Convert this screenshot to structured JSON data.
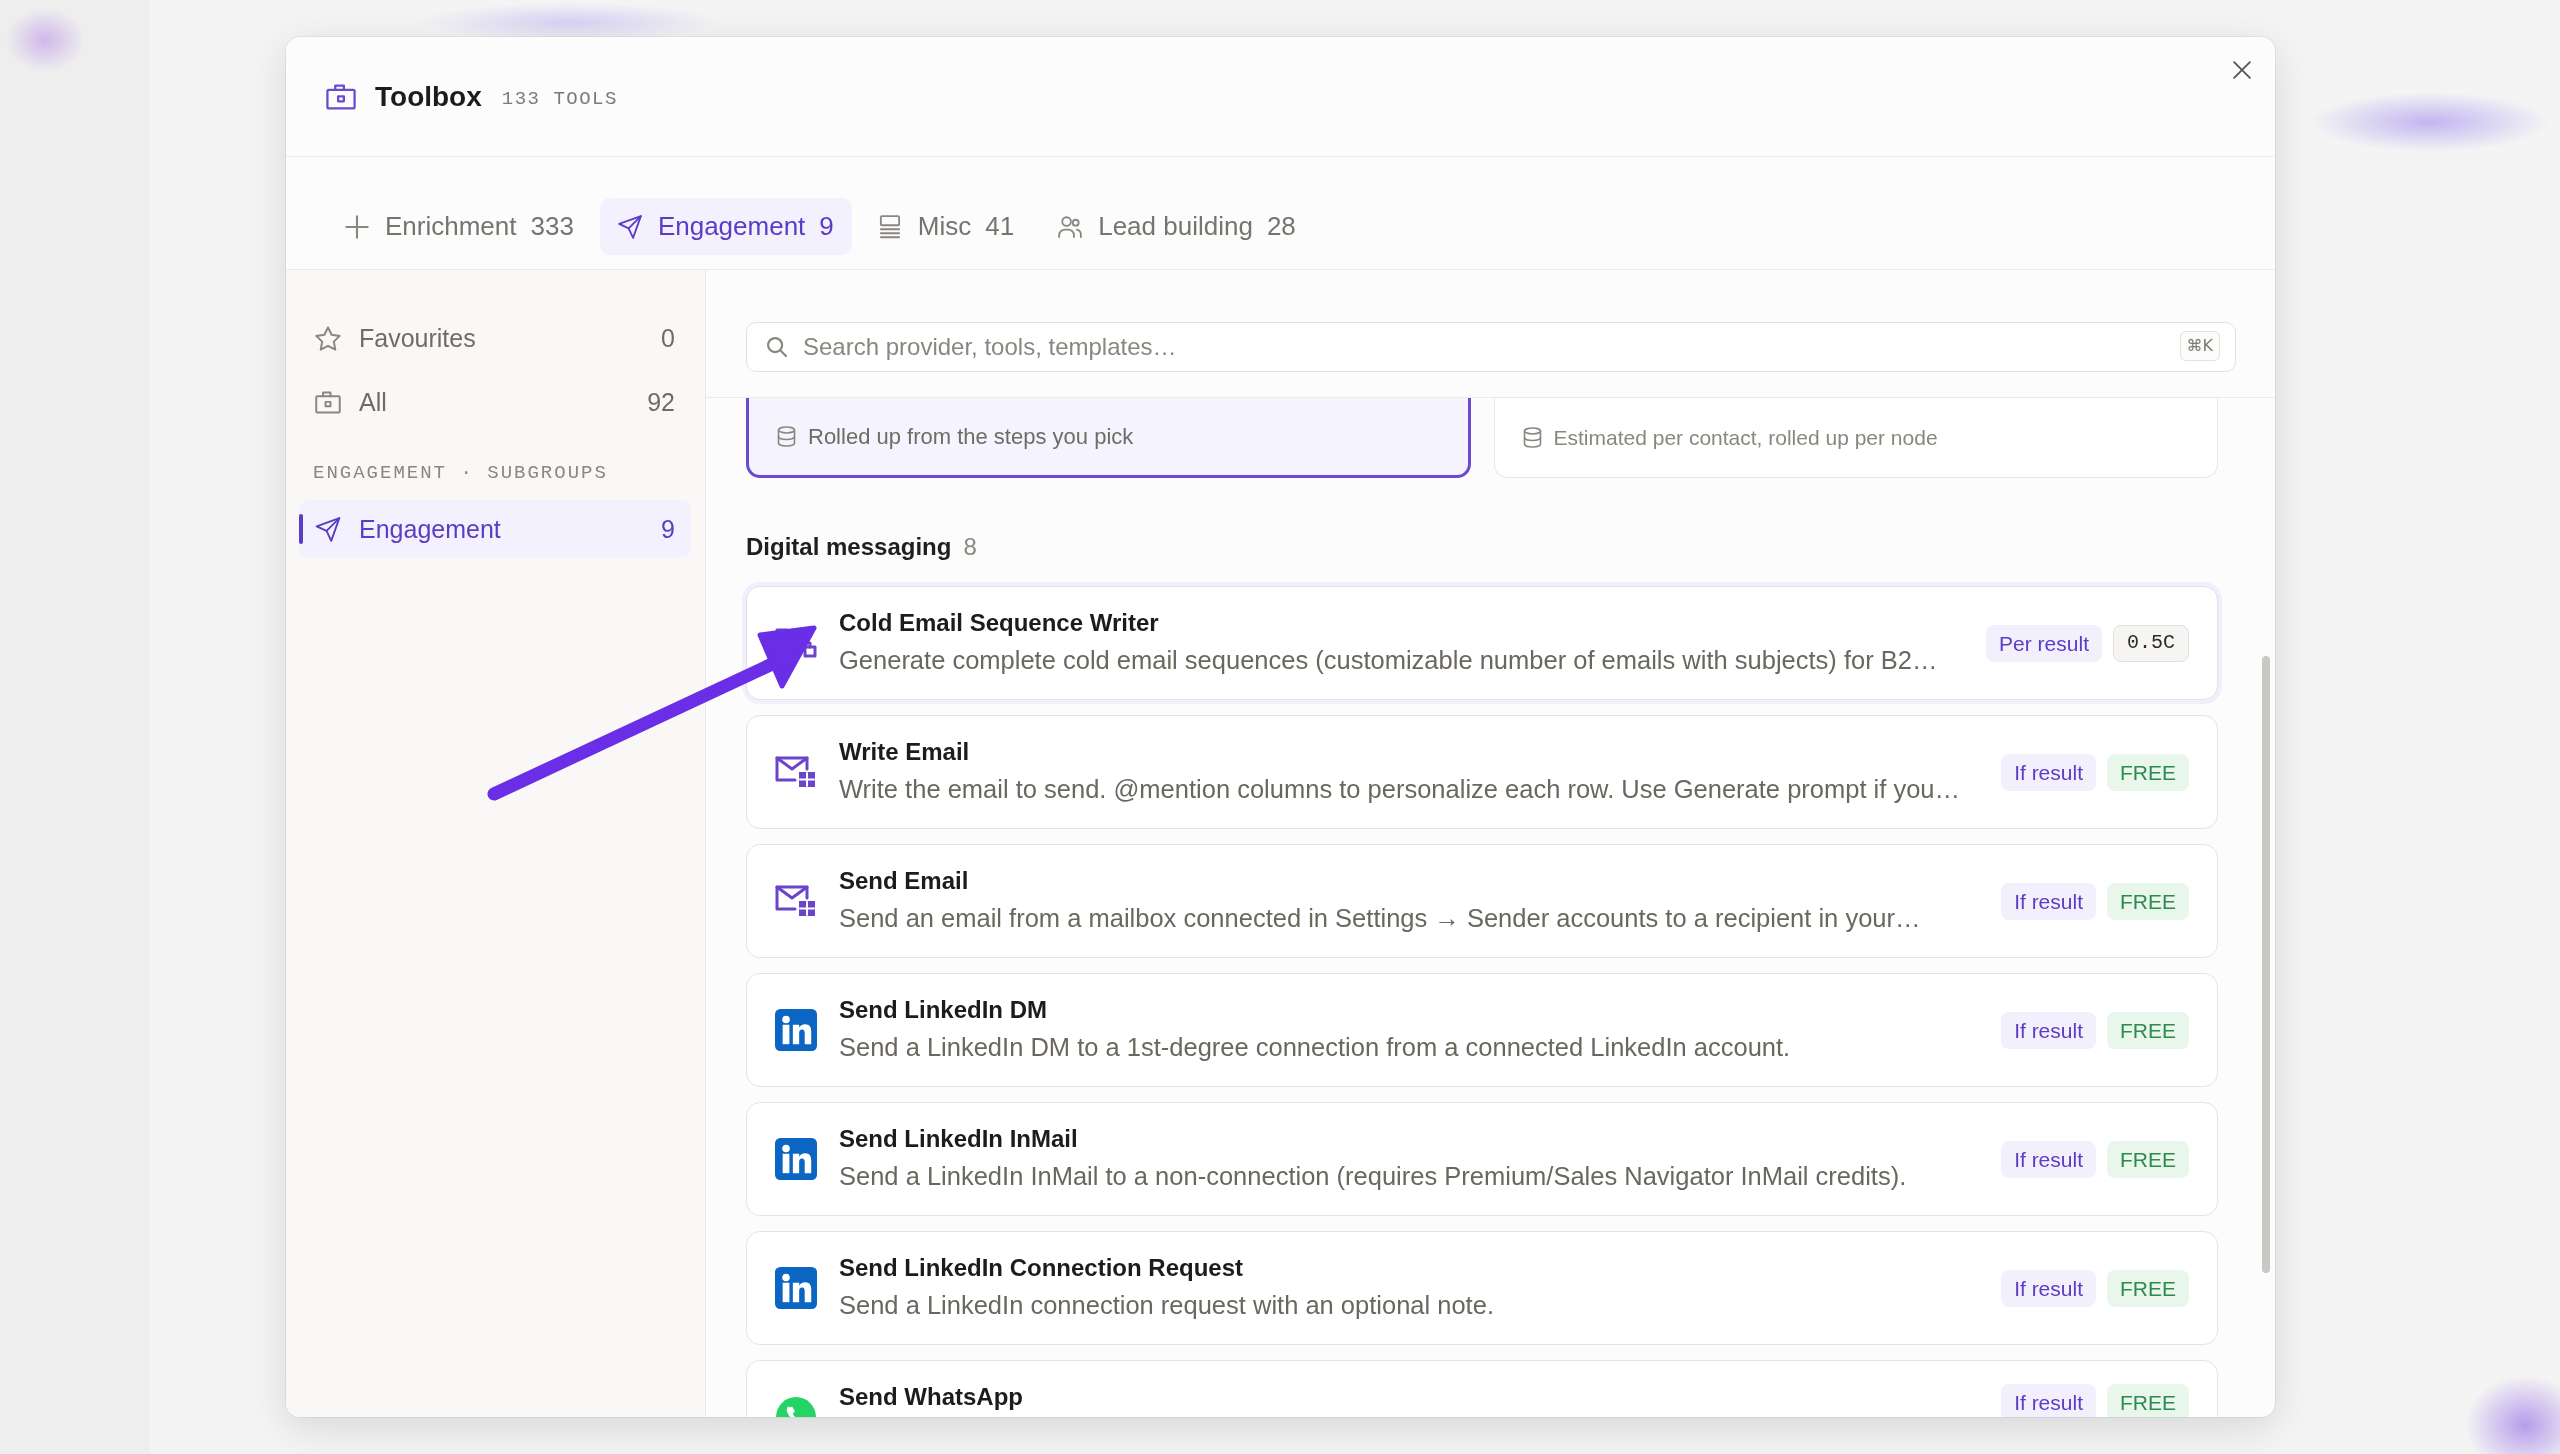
{
  "window": {
    "title": "Toolbox",
    "count": "133 TOOLS"
  },
  "tabs": [
    {
      "label": "Enrichment",
      "count": "333",
      "selected": false
    },
    {
      "label": "Engagement",
      "count": "9",
      "selected": true
    },
    {
      "label": "Misc",
      "count": "41",
      "selected": false
    },
    {
      "label": "Lead building",
      "count": "28",
      "selected": false
    }
  ],
  "sidebar": {
    "items": [
      {
        "label": "Favourites",
        "count": "0",
        "selected": false
      },
      {
        "label": "All",
        "count": "92",
        "selected": false
      }
    ],
    "section_label": "ENGAGEMENT · SUBGROUPS",
    "subgroups": [
      {
        "label": "Engagement",
        "count": "9",
        "selected": true
      }
    ]
  },
  "search": {
    "placeholder": "Search provider, tools, templates…",
    "shortcut": "⌘K"
  },
  "summary_cards": [
    {
      "note": "Rolled up from the steps you pick",
      "selected": true
    },
    {
      "note": "Estimated per contact, rolled up per node",
      "selected": false
    }
  ],
  "section": {
    "title": "Digital messaging",
    "count": "8"
  },
  "tools": [
    {
      "title": "Cold Email Sequence Writer",
      "description": "Generate complete cold email sequences (customizable number of emails with subjects) for B2…",
      "highlighted": true,
      "badges": [
        {
          "text": "Per result",
          "kind": "basis"
        },
        {
          "text": "0.5C",
          "kind": "credits"
        }
      ]
    },
    {
      "title": "Write Email",
      "description": "Write the email to send. @mention columns to personalize each row. Use Generate prompt if you…",
      "highlighted": false,
      "badges": [
        {
          "text": "If result",
          "kind": "basis"
        },
        {
          "text": "FREE",
          "kind": "free"
        }
      ]
    },
    {
      "title": "Send Email",
      "description": "Send an email from a mailbox connected in Settings → Sender accounts to a recipient in your…",
      "highlighted": false,
      "badges": [
        {
          "text": "If result",
          "kind": "basis"
        },
        {
          "text": "FREE",
          "kind": "free"
        }
      ]
    },
    {
      "title": "Send LinkedIn DM",
      "description": "Send a LinkedIn DM to a 1st-degree connection from a connected LinkedIn account.",
      "highlighted": false,
      "badges": [
        {
          "text": "If result",
          "kind": "basis"
        },
        {
          "text": "FREE",
          "kind": "free"
        }
      ]
    },
    {
      "title": "Send LinkedIn InMail",
      "description": "Send a LinkedIn InMail to a non-connection (requires Premium/Sales Navigator InMail credits).",
      "highlighted": false,
      "badges": [
        {
          "text": "If result",
          "kind": "basis"
        },
        {
          "text": "FREE",
          "kind": "free"
        }
      ]
    },
    {
      "title": "Send LinkedIn Connection Request",
      "description": "Send a LinkedIn connection request with an optional note.",
      "highlighted": false,
      "badges": [
        {
          "text": "If result",
          "kind": "basis"
        },
        {
          "text": "FREE",
          "kind": "free"
        }
      ]
    },
    {
      "title": "Send WhatsApp",
      "highlighted": false,
      "badges": [
        {
          "text": "If result",
          "kind": "basis"
        },
        {
          "text": "FREE",
          "kind": "free"
        }
      ]
    }
  ]
}
